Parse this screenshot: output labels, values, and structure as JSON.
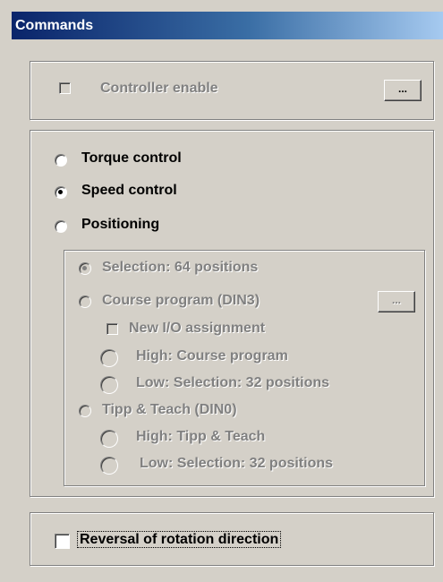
{
  "title": "Commands",
  "controller": {
    "label": "Controller enable",
    "button": "..."
  },
  "mode": {
    "options": [
      "Torque control",
      "Speed control",
      "Positioning"
    ],
    "selected": "Speed control"
  },
  "positioning": {
    "selection_64": "Selection: 64 positions",
    "course_program": "Course program (DIN3)",
    "course_button": "...",
    "new_io": "New I/O assignment",
    "high_course": "High: Course program",
    "low_sel_32_a": "Low: Selection: 32 positions",
    "tipp_teach": "Tipp & Teach (DIN0)",
    "high_tipp": "High: Tipp & Teach",
    "low_sel_32_b": "Low: Selection: 32 positions"
  },
  "reversal": {
    "label": "Reversal of rotation direction"
  },
  "colors": {
    "title_start": "#0a246a",
    "title_end": "#a6caf0",
    "face": "#d4d0c8",
    "disabled": "#808080"
  }
}
